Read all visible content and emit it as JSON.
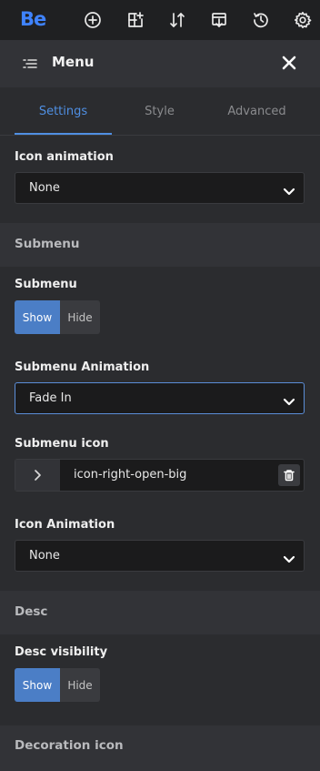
{
  "app": {
    "logo_text": "Be",
    "accent": "#3f83ff"
  },
  "toolbar": {
    "icons": [
      "add-icon",
      "layout-add-icon",
      "sort-arrows-icon",
      "import-icon",
      "history-icon",
      "settings-gear-icon"
    ]
  },
  "panel": {
    "title": "Menu"
  },
  "tabs": [
    {
      "label": "Settings",
      "active": true
    },
    {
      "label": "Style",
      "active": false
    },
    {
      "label": "Advanced",
      "active": false
    }
  ],
  "fields": {
    "icon_animation": {
      "label": "Icon animation",
      "value": "None"
    },
    "submenu_section": "Submenu",
    "submenu": {
      "label": "Submenu",
      "on": "Show",
      "off": "Hide",
      "selected": "Show"
    },
    "submenu_animation": {
      "label": "Submenu Animation",
      "value": "Fade In"
    },
    "submenu_icon": {
      "label": "Submenu icon",
      "value": "icon-right-open-big"
    },
    "icon_animation_2": {
      "label": "Icon Animation",
      "value": "None"
    },
    "desc_section": "Desc",
    "desc_visibility": {
      "label": "Desc visibility",
      "on": "Show",
      "off": "Hide",
      "selected": "Show"
    },
    "decoration_section": "Decoration icon"
  }
}
